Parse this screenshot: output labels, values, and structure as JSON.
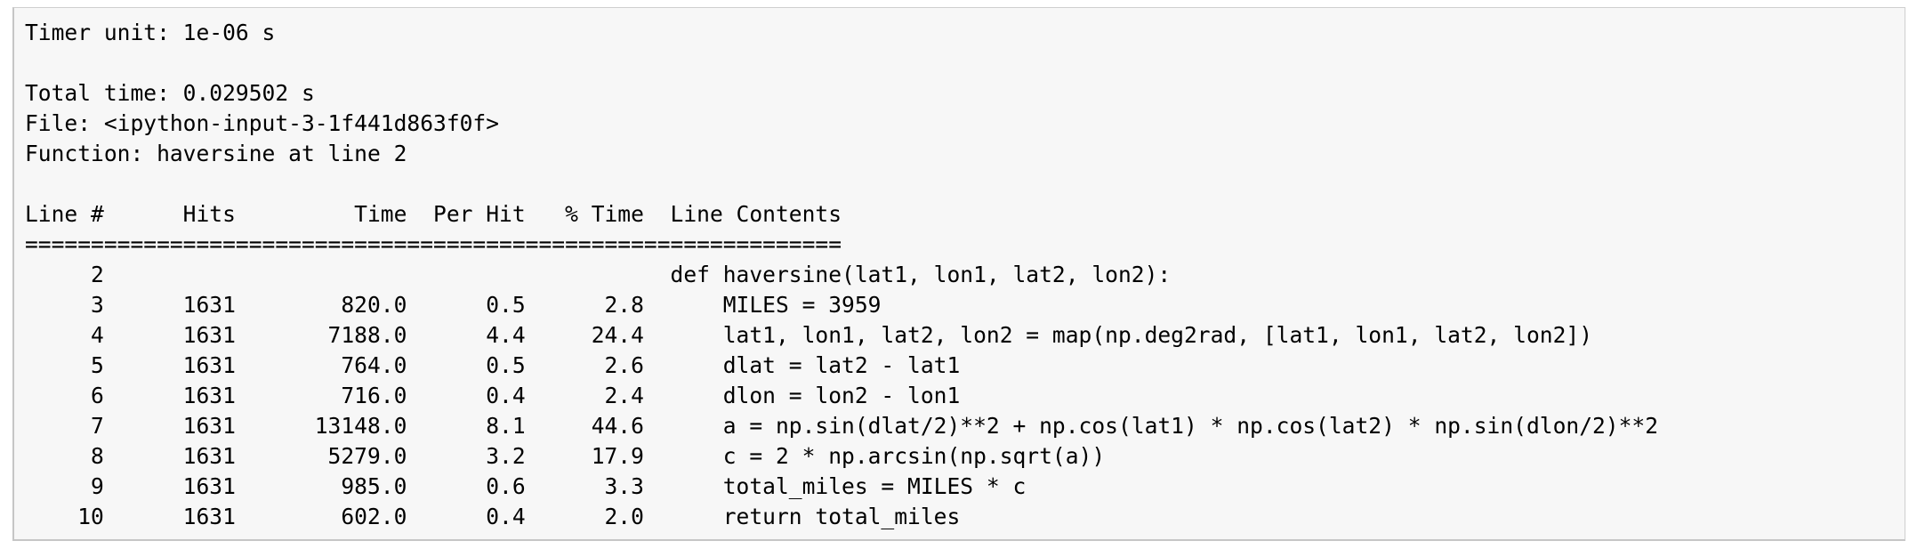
{
  "profiler": {
    "timer_unit": "Timer unit: 1e-06 s",
    "total_time": "Total time: 0.029502 s",
    "file": "File: <ipython-input-3-1f441d863f0f>",
    "function": "Function: haversine at line 2",
    "table_header": "Line #      Hits         Time  Per Hit   % Time  Line Contents",
    "separator": "==============================================================",
    "rows": [
      "     2                                           def haversine(lat1, lon1, lat2, lon2):",
      "     3      1631        820.0      0.5      2.8      MILES = 3959",
      "     4      1631       7188.0      4.4     24.4      lat1, lon1, lat2, lon2 = map(np.deg2rad, [lat1, lon1, lat2, lon2])",
      "     5      1631        764.0      0.5      2.6      dlat = lat2 - lat1",
      "     6      1631        716.0      0.4      2.4      dlon = lon2 - lon1",
      "     7      1631      13148.0      8.1     44.6      a = np.sin(dlat/2)**2 + np.cos(lat1) * np.cos(lat2) * np.sin(dlon/2)**2",
      "     8      1631       5279.0      3.2     17.9      c = 2 * np.arcsin(np.sqrt(a))",
      "     9      1631        985.0      0.6      3.3      total_miles = MILES * c",
      "    10      1631        602.0      0.4      2.0      return total_miles"
    ]
  }
}
